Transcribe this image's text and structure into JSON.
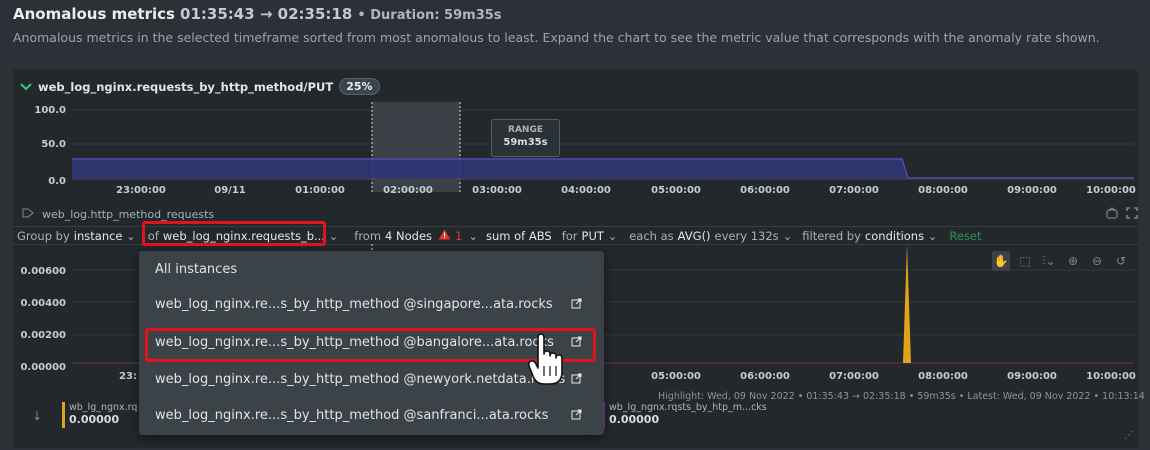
{
  "header": {
    "title": "Anomalous metrics",
    "range": "01:35:43 → 02:35:18",
    "duration": "• Duration: 59m35s",
    "description": "Anomalous metrics in the selected timeframe sorted from most anomalous to least. Expand the chart to see the metric value that corresponds with the anomaly rate shown."
  },
  "metric": {
    "name": "web_log_nginx.requests_by_http_method/PUT",
    "badge": "25%"
  },
  "top_chart": {
    "y_ticks": [
      "100.0",
      "50.0",
      "0.0"
    ],
    "x_ticks": [
      "23:00:00",
      "09/11",
      "01:00:00",
      "02:00:00",
      "03:00:00",
      "04:00:00",
      "05:00:00",
      "06:00:00",
      "07:00:00",
      "08:00:00",
      "09:00:00",
      "10:00:00"
    ],
    "range_label": "RANGE",
    "range_value": "59m35s",
    "accent": "#4a4fa8"
  },
  "context": {
    "name": "web_log.http_method_requests"
  },
  "toolbar": {
    "group_by_label": "Group by",
    "group_by_value": "instance",
    "of_label": "of",
    "of_value": "web_log_nginx.requests_b...",
    "from_label": "from",
    "from_value": "4 Nodes",
    "alert_count": "1",
    "agg_label": "sum of ABS",
    "for_label": "for",
    "for_value": "PUT",
    "each_label": "each as",
    "each_value": "AVG()",
    "every_label": "every 132s",
    "filtered_label": "filtered by",
    "filtered_value": "conditions",
    "reset_label": "Reset"
  },
  "dropdown": {
    "items": [
      "All instances",
      "web_log_nginx.re...s_by_http_method @singapore...ata.rocks",
      "web_log_nginx.re...s_by_http_method @bangalore...ata.rocks",
      "web_log_nginx.re...s_by_http_method @newyork.netdata.rocks",
      "web_log_nginx.re...s_by_http_method @sanfranci...ata.rocks"
    ]
  },
  "bottom_chart": {
    "y_ticks": [
      "0.00600",
      "0.00400",
      "0.00200",
      "0.00000"
    ],
    "x_ticks": [
      "23:",
      "05:00:00",
      "06:00:00",
      "07:00:00",
      "08:00:00",
      "09:00:00",
      "10:00:00"
    ],
    "spike_color": "#e0a31c",
    "highlight_note": "Highlight: Wed, 09 Nov 2022 • 01:35:43 → 02:35:18 • 59m35s • Latest: Wed, 09 Nov 2022 • 10:13:14"
  },
  "legend": [
    {
      "name": "wb_lg_ngnx.rq",
      "value": "0.00000",
      "color": "#e0a31c"
    },
    {
      "name": "wb_lg_ngnx.rqsts_by_htp_m...cks",
      "value": "0.00000",
      "color": "#9b2fae"
    }
  ],
  "colors": {
    "highlight_border": "#e1141c",
    "accent_green": "#3cc37c"
  }
}
